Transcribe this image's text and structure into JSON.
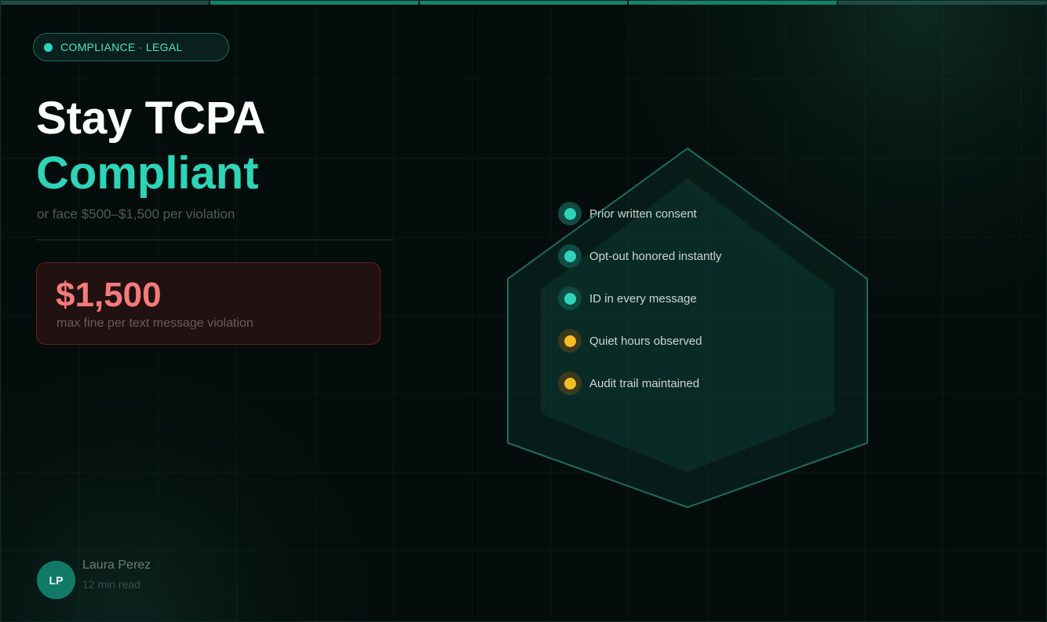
{
  "badge": {
    "label": "COMPLIANCE · LEGAL"
  },
  "headline": {
    "line1": "Stay TCPA",
    "line2": "Compliant",
    "subtitle": "or face $500–$1,500 per violation"
  },
  "fine": {
    "amount": "$1,500",
    "caption": "max fine per text message violation"
  },
  "checklist": [
    {
      "label": "Prior written consent",
      "status": "teal"
    },
    {
      "label": "Opt-out honored instantly",
      "status": "teal"
    },
    {
      "label": "ID in every message",
      "status": "teal"
    },
    {
      "label": "Quiet hours observed",
      "status": "amber"
    },
    {
      "label": "Audit trail maintained",
      "status": "amber"
    }
  ],
  "author": {
    "initials": "LP",
    "name": "Laura Perez",
    "read_time": "12 min read"
  },
  "colors": {
    "accent": "#2dd4b8",
    "warning": "#f5bd25",
    "danger": "#f47b7b",
    "background": "#040d0b"
  }
}
